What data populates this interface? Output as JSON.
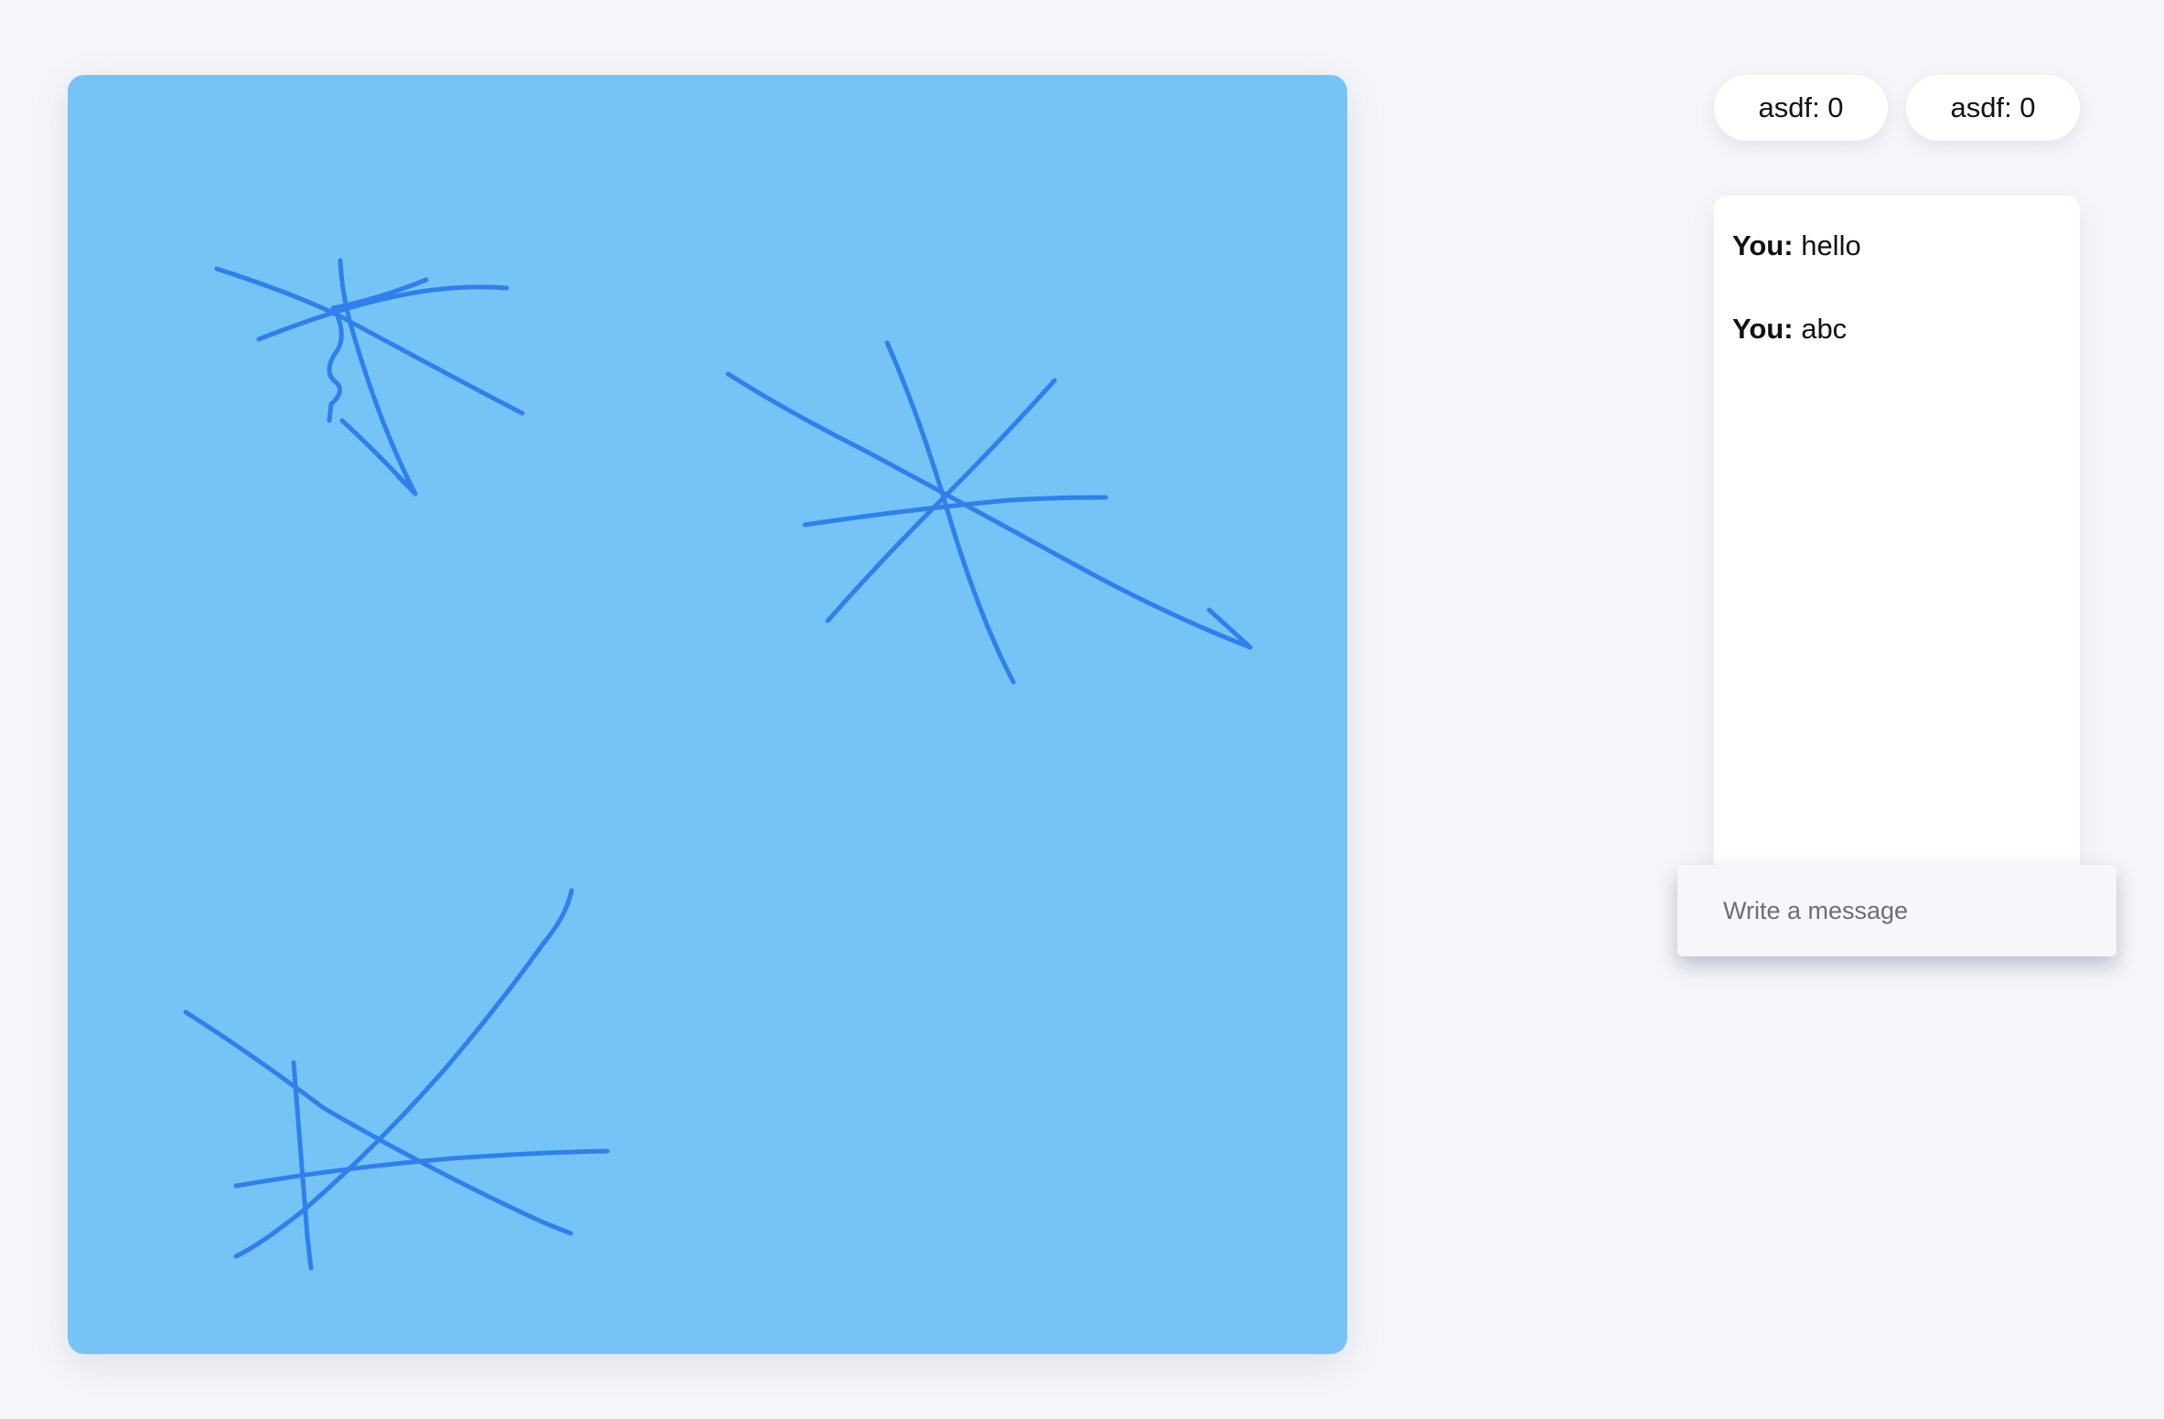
{
  "scoreboard": [
    {
      "name": "asdf",
      "score": "0"
    },
    {
      "name": "asdf",
      "score": "0"
    }
  ],
  "chat": {
    "messages": [
      {
        "author": "You:",
        "text": "hello"
      },
      {
        "author": "You:",
        "text": "abc"
      }
    ],
    "input": {
      "placeholder": "Write a message",
      "value": ""
    }
  },
  "canvas": {
    "background_color": "#76c4f5",
    "stroke_color": "#2f80ed"
  }
}
